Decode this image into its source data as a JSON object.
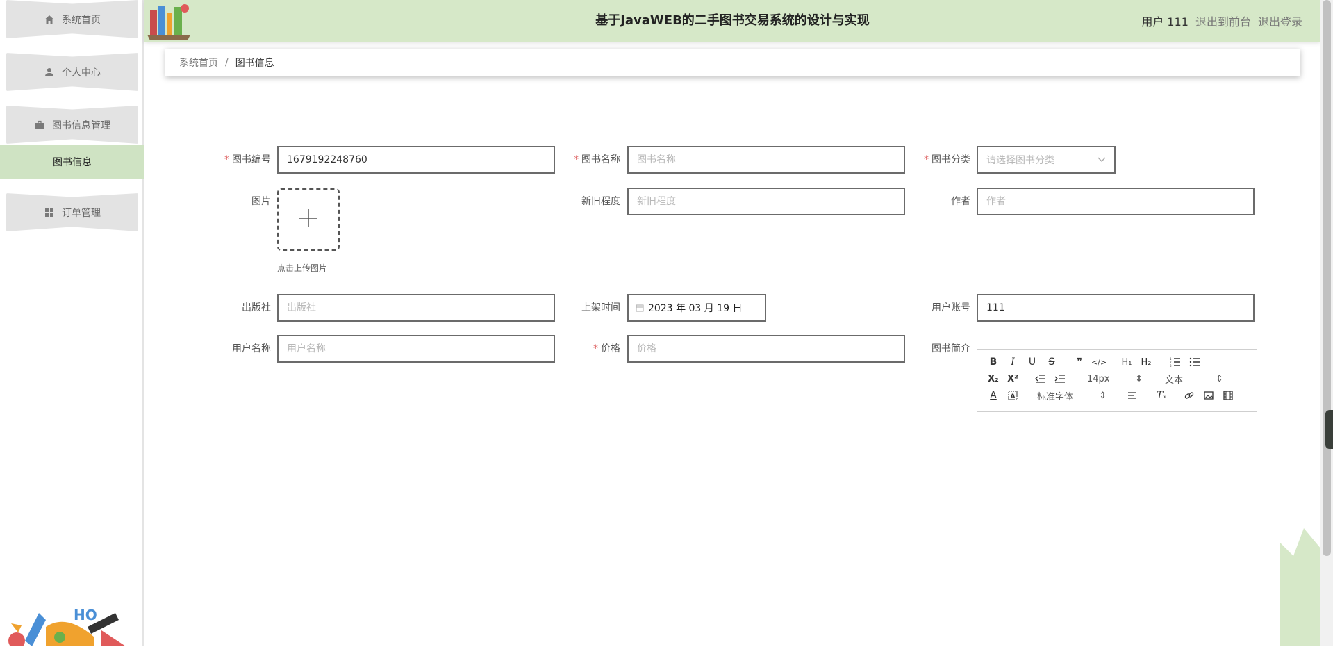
{
  "header": {
    "title": "基于JavaWEB的二手图书交易系统的设计与实现",
    "user_label": "用户 111",
    "to_front_label": "退出到前台",
    "logout_label": "退出登录"
  },
  "sidebar": {
    "items": [
      {
        "label": "系统首页",
        "icon": "home-icon"
      },
      {
        "label": "个人中心",
        "icon": "user-icon"
      },
      {
        "label": "图书信息管理",
        "icon": "briefcase-icon"
      },
      {
        "label": "订单管理",
        "icon": "grid-icon"
      }
    ],
    "submenu_active": "图书信息",
    "active_color": "#cfe3c3"
  },
  "breadcrumb": {
    "home": "系统首页",
    "separator": "/",
    "current": "图书信息"
  },
  "form": {
    "book_no": {
      "label": "图书编号",
      "value": "1679192248760",
      "required": true
    },
    "book_name": {
      "label": "图书名称",
      "placeholder": "图书名称",
      "required": true
    },
    "book_category": {
      "label": "图书分类",
      "placeholder": "请选择图书分类",
      "required": true
    },
    "image": {
      "label": "图片",
      "tip": "点击上传图片"
    },
    "condition": {
      "label": "新旧程度",
      "placeholder": "新旧程度"
    },
    "author": {
      "label": "作者",
      "placeholder": "作者"
    },
    "publisher": {
      "label": "出版社",
      "placeholder": "出版社"
    },
    "listing_date": {
      "label": "上架时间",
      "value": "2023 年 03 月 19 日"
    },
    "user_account": {
      "label": "用户账号",
      "value": "111"
    },
    "user_name": {
      "label": "用户名称",
      "placeholder": "用户名称"
    },
    "price": {
      "label": "价格",
      "placeholder": "价格",
      "required": true
    },
    "intro": {
      "label": "图书简介"
    }
  },
  "editor": {
    "font_size": "14px",
    "heading": "文本",
    "font_family": "标准字体"
  },
  "colors": {
    "header_bg": "#d6e8c8",
    "required_star": "#e06a6a"
  }
}
